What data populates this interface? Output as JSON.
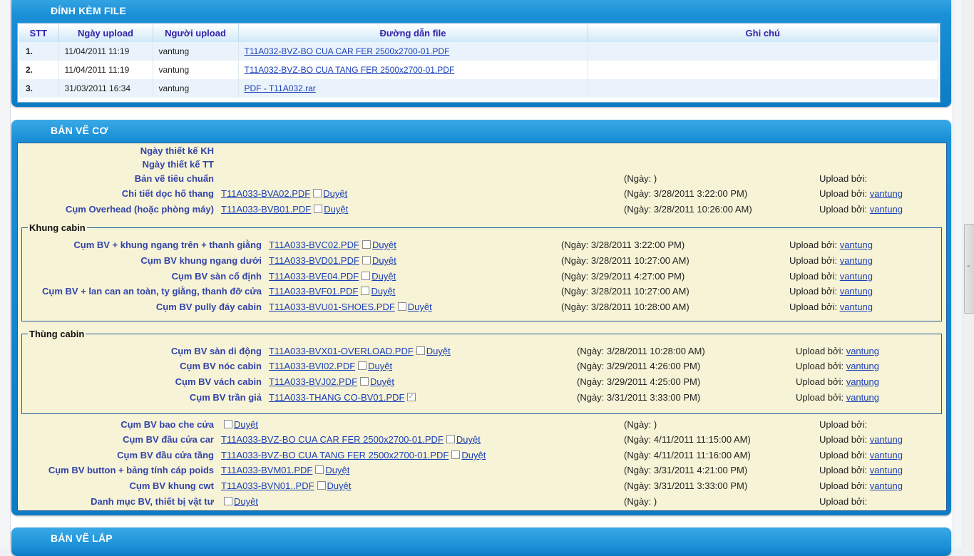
{
  "attach": {
    "title": "ĐÍNH KÈM FILE",
    "headers": {
      "stt": "STT",
      "date": "Ngày upload",
      "user": "Người upload",
      "path": "Đường dẫn file",
      "note": "Ghi chú"
    },
    "rows": [
      {
        "stt": "1.",
        "date": "11/04/2011 11:19",
        "user": "vantung",
        "file": "T11A032-BVZ-BO CUA CAR FER 2500x2700-01.PDF",
        "note": ""
      },
      {
        "stt": "2.",
        "date": "11/04/2011 11:19",
        "user": "vantung",
        "file": "T11A032-BVZ-BO CUA TANG FER 2500x2700-01.PDF",
        "note": ""
      },
      {
        "stt": "3.",
        "date": "31/03/2011 16:34",
        "user": "vantung",
        "file": "PDF - T11A032.rar",
        "note": ""
      }
    ]
  },
  "mech": {
    "title": "BẢN VẼ CƠ",
    "approve": "Duyệt",
    "upload_by": "Upload bởi:",
    "top": [
      {
        "label": "Ngày thiết kế KH"
      },
      {
        "label": "Ngày thiết kế TT"
      },
      {
        "label": "Bản vẽ tiêu chuẩn",
        "date": "(Ngày: )",
        "user": ""
      },
      {
        "label": "Chi tiết dọc hố thang",
        "file": "T11A033-BVA02.PDF",
        "date": "(Ngày: 3/28/2011 3:22:00 PM)",
        "user": "vantung"
      },
      {
        "label": "Cụm Overhead (hoặc phòng máy)",
        "file": "T11A033-BVB01.PDF",
        "date": "(Ngày: 3/28/2011 10:26:00 AM)",
        "user": "vantung"
      }
    ],
    "khung": {
      "legend": "Khung cabin",
      "rows": [
        {
          "label": "Cụm BV + khung ngang trên + thanh giằng",
          "file": "T11A033-BVC02.PDF",
          "date": "(Ngày: 3/28/2011 3:22:00 PM)",
          "user": "vantung"
        },
        {
          "label": "Cụm BV khung ngang dưới",
          "file": "T11A033-BVD01.PDF",
          "date": "(Ngày: 3/28/2011 10:27:00 AM)",
          "user": "vantung"
        },
        {
          "label": "Cụm BV sàn cố định",
          "file": "T11A033-BVE04.PDF",
          "date": "(Ngày: 3/29/2011 4:27:00 PM)",
          "user": "vantung"
        },
        {
          "label": "Cụm BV + lan can an toàn, ty giằng, thanh đỡ cửa",
          "file": "T11A033-BVF01.PDF",
          "date": "(Ngày: 3/28/2011 10:27:00 AM)",
          "user": "vantung"
        },
        {
          "label": "Cụm BV pully đáy cabin",
          "file": "T11A033-BVU01-SHOES.PDF",
          "date": "(Ngày: 3/28/2011 10:28:00 AM)",
          "user": "vantung"
        }
      ]
    },
    "thung": {
      "legend": "Thùng cabin",
      "rows": [
        {
          "label": "Cụm BV sàn di động",
          "file": "T11A033-BVX01-OVERLOAD.PDF",
          "date": "(Ngày: 3/28/2011 10:28:00 AM)",
          "user": "vantung",
          "checked": false
        },
        {
          "label": "Cụm BV nóc cabin",
          "file": "T11A033-BVI02.PDF",
          "date": "(Ngày: 3/29/2011 4:26:00 PM)",
          "user": "vantung",
          "checked": false
        },
        {
          "label": "Cụm BV vách cabin",
          "file": "T11A033-BVJ02.PDF",
          "date": "(Ngày: 3/29/2011 4:25:00 PM)",
          "user": "vantung",
          "checked": false
        },
        {
          "label": "Cụm BV trần giả",
          "file": "T11A033-THANG CO-BV01.PDF",
          "date": "(Ngày: 3/31/2011 3:33:00 PM)",
          "user": "vantung",
          "checked": true
        }
      ]
    },
    "bottom": [
      {
        "label": "Cụm BV bao che cửa",
        "file": "",
        "date": "(Ngày: )",
        "user": ""
      },
      {
        "label": "Cụm BV đầu cửa car",
        "file": "T11A033-BVZ-BO CUA CAR FER 2500x2700-01.PDF",
        "date": "(Ngày: 4/11/2011 11:15:00 AM)",
        "user": "vantung"
      },
      {
        "label": "Cụm BV đầu cửa tầng",
        "file": "T11A033-BVZ-BO CUA TANG FER 2500x2700-01.PDF",
        "date": "(Ngày: 4/11/2011 11:16:00 AM)",
        "user": "vantung"
      },
      {
        "label": "Cụm BV button + bảng tính cáp poids",
        "file": "T11A033-BVM01.PDF",
        "date": "(Ngày: 3/31/2011 4:21:00 PM)",
        "user": "vantung"
      },
      {
        "label": "Cụm BV khung cwt",
        "file": "T11A033-BVN01..PDF",
        "date": "(Ngày: 3/31/2011 3:33:00 PM)",
        "user": "vantung"
      },
      {
        "label": "Danh mục BV, thiết bị vật tư",
        "file": "",
        "date": "(Ngày: )",
        "user": ""
      }
    ]
  },
  "assembly": {
    "title": "BẢN VẼ LẮP"
  },
  "colors": {
    "panel": "#1a8fd6",
    "body_bg": "#f7f3d6",
    "label": "#3344aa",
    "link": "#1a3fb8"
  }
}
